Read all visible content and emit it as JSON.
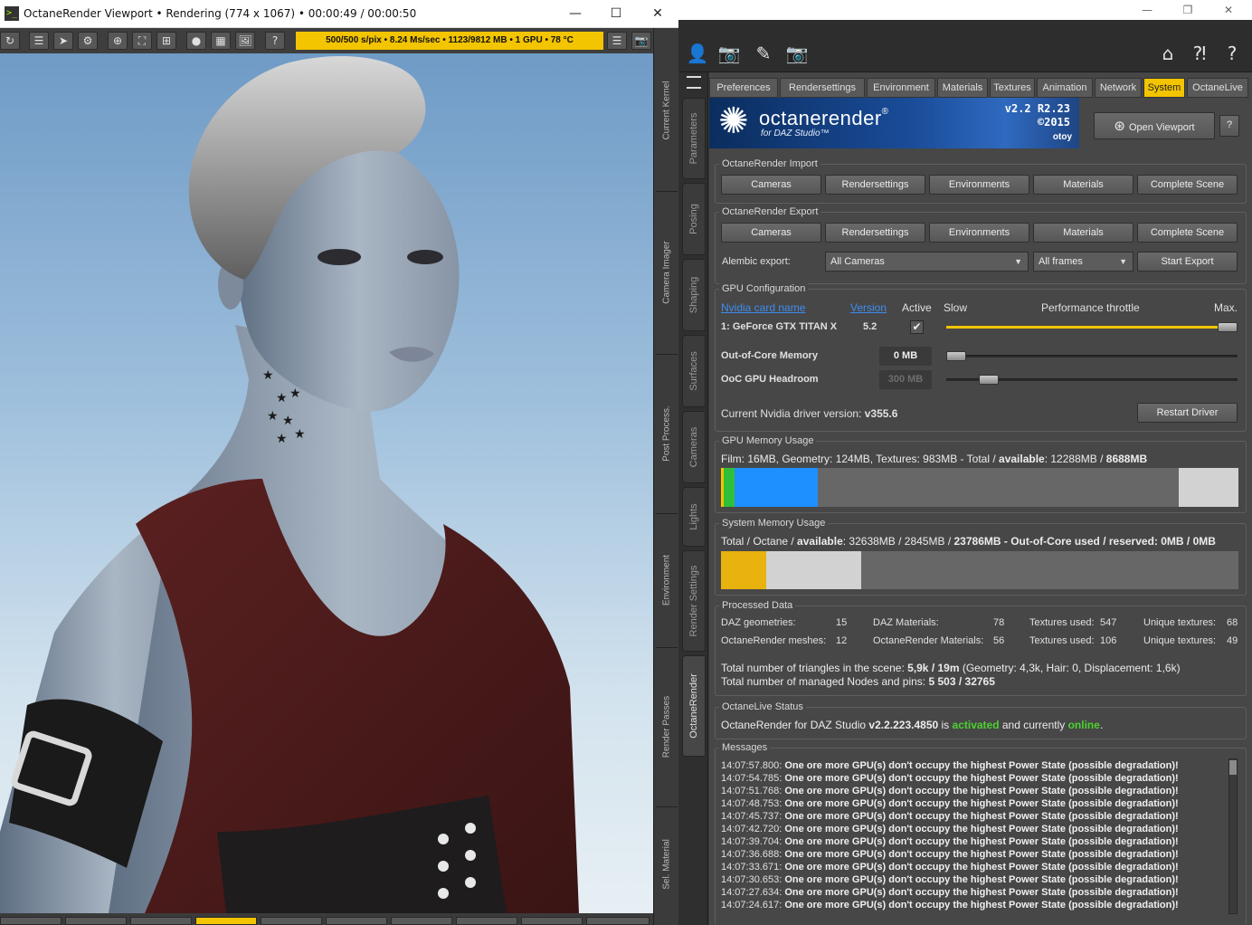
{
  "viewport": {
    "title": "OctaneRender Viewport • Rendering (774 x 1067) • 00:00:49 / 00:00:50",
    "status": "500/500 s/pix • 8.24 Ms/sec • 1123/9812 MB • 1 GPU • 78 °C",
    "app_icon": ">_",
    "window_controls": [
      "—",
      "☐",
      "✕"
    ],
    "tools": [
      "↻",
      "☰",
      "➤",
      "⚙",
      "⊕",
      "⛶",
      "⊞",
      "●",
      "▦",
      "🖼",
      "?",
      "☰",
      "📷"
    ],
    "side_tabs": [
      "Current Kernel",
      "Camera Imager",
      "Post Process.",
      "Environment",
      "Render Passes",
      "Sel. Material"
    ]
  },
  "daz": {
    "window_controls": [
      "—",
      "❐",
      "✕"
    ],
    "toolbar_icons": [
      "👤",
      "📷",
      "✎",
      "📷"
    ],
    "toolbar_right_icons": [
      "⌂",
      "⁈",
      "?"
    ],
    "side_tabs": [
      "Parameters",
      "Posing",
      "Shaping",
      "Surfaces",
      "Cameras",
      "Lights",
      "Render Settings",
      "OctaneRender"
    ]
  },
  "octane": {
    "tabs": [
      "Preferences",
      "Rendersettings",
      "Environment",
      "Materials",
      "Textures",
      "Animation",
      "Network",
      "System",
      "OctaneLive"
    ],
    "banner": {
      "brand": "octanerender",
      "brand_mark": "®",
      "sub": "for DAZ Studio™",
      "version": "v2.2  R2.23",
      "year": "©2015",
      "otoy": "otoy"
    },
    "open_viewport": "Open Viewport",
    "help": "?",
    "import": {
      "title": "OctaneRender Import",
      "buttons": [
        "Cameras",
        "Rendersettings",
        "Environments",
        "Materials",
        "Complete Scene"
      ]
    },
    "export": {
      "title": "OctaneRender Export",
      "buttons": [
        "Cameras",
        "Rendersettings",
        "Environments",
        "Materials",
        "Complete Scene"
      ],
      "alembic_label": "Alembic export:",
      "cameras_select": "All Cameras",
      "frames_select": "All frames",
      "start_export": "Start Export"
    },
    "gpu": {
      "title": "GPU Configuration",
      "col_name": "Nvidia card name",
      "col_version": "Version",
      "col_active": "Active",
      "slow": "Slow",
      "throttle": "Performance throttle",
      "max": "Max.",
      "card": "1: GeForce GTX TITAN X",
      "card_version": "5.2",
      "active_checked": true,
      "throttle_level": 1.0,
      "ooc_label": "Out-of-Core Memory",
      "ooc_value": "0 MB",
      "ooc_level": 0.0,
      "headroom_label": "OoC GPU Headroom",
      "headroom_value": "300 MB",
      "headroom_level": 0.12,
      "driver_label": "Current Nvidia driver version:",
      "driver_value": "v355.6",
      "restart": "Restart Driver"
    },
    "gpu_memory": {
      "title": "GPU Memory Usage",
      "text_prefix": "Film: 16MB, Geometry: 124MB, Textures: 983MB - Total / ",
      "text_bold1": "available",
      "text_mid": ": 12288MB / ",
      "text_bold2": "8688MB",
      "film_mb": 16,
      "geometry_mb": 124,
      "textures_mb": 983,
      "total_mb": 12288,
      "available_mb": 8688,
      "colors": [
        "#f3c400",
        "#2fbf3a",
        "#1e90ff"
      ]
    },
    "sys_memory": {
      "title": "System Memory Usage",
      "text_prefix": "Total / Octane / ",
      "text_bold1": "available",
      "text_mid": ": 32638MB / 2845MB / ",
      "text_bold2": "23786MB - Out-of-Core used / reserved: 0MB / 0MB",
      "total_mb": 32638,
      "octane_mb": 2845,
      "available_mb": 23786
    },
    "processed": {
      "title": "Processed Data",
      "row1": [
        {
          "label": "DAZ geometries:",
          "value": "15"
        },
        {
          "label": "DAZ Materials:",
          "value": "78"
        },
        {
          "label": "Textures used:",
          "value": "547"
        },
        {
          "label": "Unique textures:",
          "value": "68"
        }
      ],
      "row2": [
        {
          "label": "OctaneRender meshes:",
          "value": "12"
        },
        {
          "label": "OctaneRender Materials:",
          "value": "56"
        },
        {
          "label": "Textures used:",
          "value": "106"
        },
        {
          "label": "Unique textures:",
          "value": "49"
        }
      ],
      "tri_prefix": "Total number of triangles in the scene: ",
      "tri_bold": "5,9k / 19m",
      "tri_suffix": " (Geometry: 4,3k, Hair: 0, Displacement: 1,6k)",
      "nodes_prefix": "Total number of managed Nodes and pins: ",
      "nodes_bold": "5 503 / 32765"
    },
    "live": {
      "title": "OctaneLive Status",
      "prefix": "OctaneRender for DAZ Studio ",
      "version": "v2.2.223.4850",
      "is": " is ",
      "activated": "activated",
      "and": " and currently ",
      "online": "online",
      "dot": "."
    },
    "messages": {
      "title": "Messages",
      "text": "One ore more GPU(s) don't occupy the highest Power State (possible degradation)!",
      "times": [
        "14:07:57.800:",
        "14:07:54.785:",
        "14:07:51.768:",
        "14:07:48.753:",
        "14:07:45.737:",
        "14:07:42.720:",
        "14:07:39.704:",
        "14:07:36.688:",
        "14:07:33.671:",
        "14:07:30.653:",
        "14:07:27.634:",
        "14:07:24.617:"
      ]
    }
  }
}
